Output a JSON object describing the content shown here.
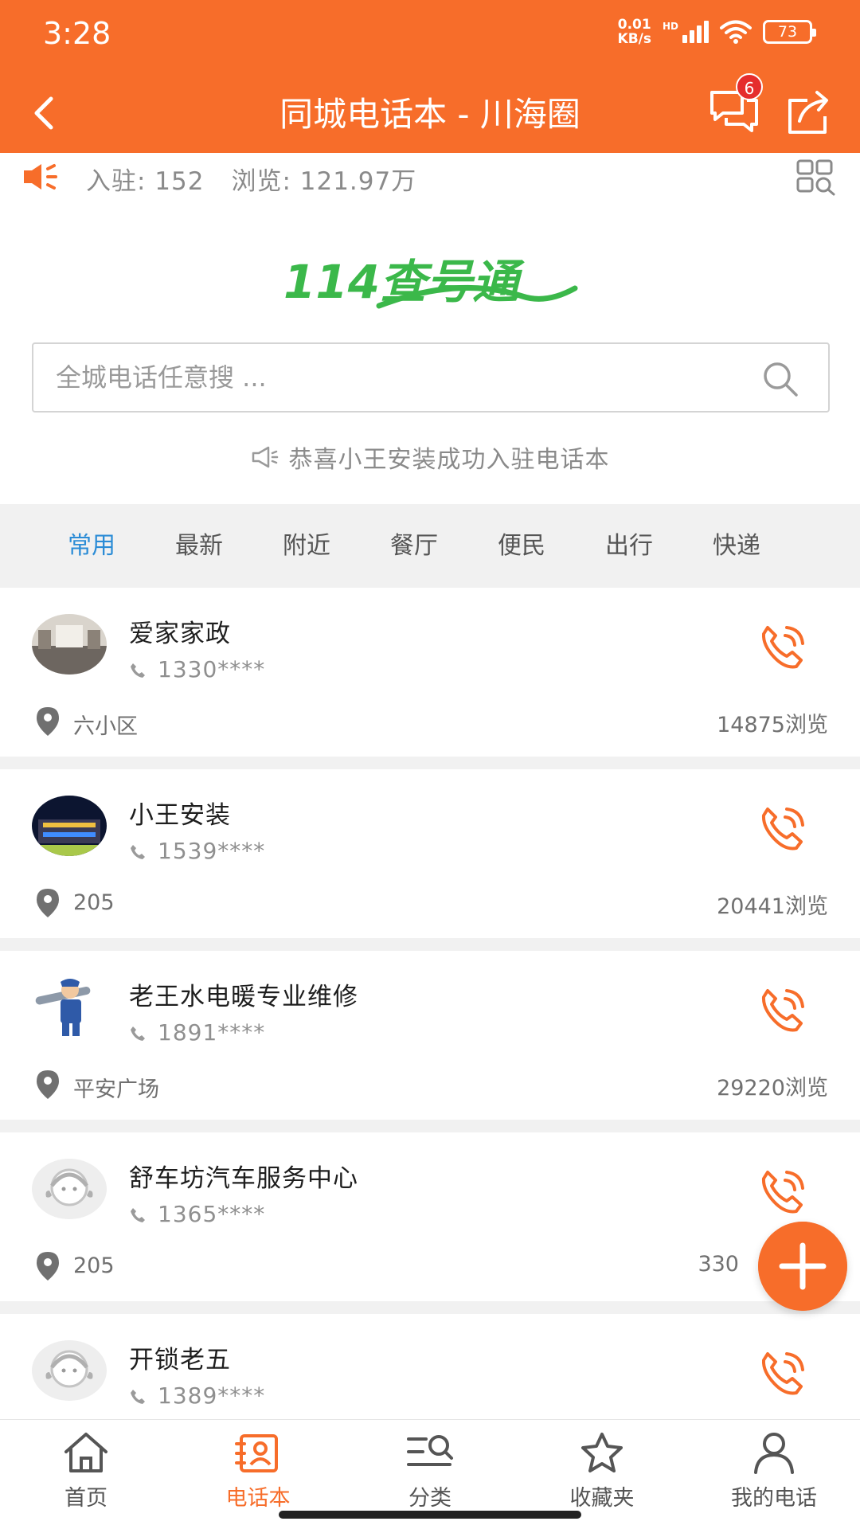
{
  "status_bar": {
    "time": "3:28",
    "net_speed_value": "0.01",
    "net_speed_unit": "KB/s",
    "hd_label": "HD",
    "battery": "73"
  },
  "header": {
    "title": "同城电话本 - 川海圈",
    "message_badge": "6"
  },
  "stats": {
    "joined": "入驻: 152",
    "views": "浏览: 121.97万"
  },
  "logo_text": "114查号通",
  "search": {
    "placeholder": "全城电话任意搜 ..."
  },
  "announcement": "恭喜小王安装成功入驻电话本",
  "tabs": [
    {
      "label": "常用"
    },
    {
      "label": "最新"
    },
    {
      "label": "附近"
    },
    {
      "label": "餐厅"
    },
    {
      "label": "便民"
    },
    {
      "label": "出行"
    },
    {
      "label": "快递"
    }
  ],
  "listings": [
    {
      "name": "爱家家政",
      "phone": "1330****",
      "location": "六小区",
      "views": "14875浏览"
    },
    {
      "name": "小王安装",
      "phone": "1539****",
      "location": "205",
      "views": "20441浏览"
    },
    {
      "name": "老王水电暖专业维修",
      "phone": "1891****",
      "location": "平安广场",
      "views": "29220浏览"
    },
    {
      "name": "舒车坊汽车服务中心",
      "phone": "1365****",
      "location": "205",
      "views": "330"
    },
    {
      "name": "开锁老五",
      "phone": "1389****",
      "location": "",
      "views": ""
    }
  ],
  "bottom_nav": [
    {
      "label": "首页"
    },
    {
      "label": "电话本"
    },
    {
      "label": "分类"
    },
    {
      "label": "收藏夹"
    },
    {
      "label": "我的电话"
    }
  ],
  "colors": {
    "brand_orange": "#f76d2a",
    "active_tab_blue": "#2b8cd6",
    "badge_red": "#e52d2d",
    "logo_green": "#3bb84a",
    "logo_dark": "#23314a"
  }
}
